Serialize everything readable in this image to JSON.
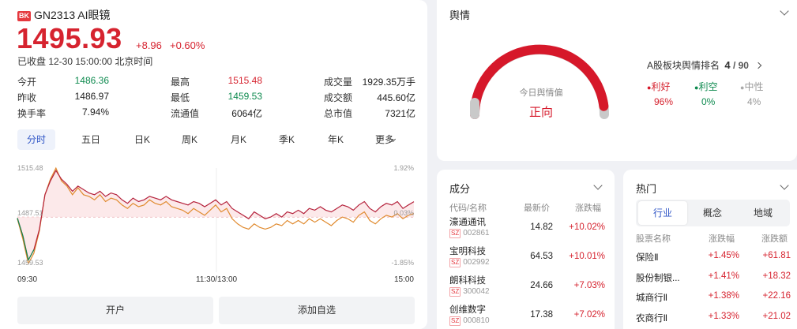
{
  "stock": {
    "badge": "BK",
    "name": "GN2313 AI眼镜",
    "price": "1495.93",
    "change": "+8.96",
    "change_pct": "+0.60%",
    "status": "已收盘 12-30 15:00:00 北京时间"
  },
  "stats": [
    {
      "label": "今开",
      "value": "1486.36",
      "color": "green"
    },
    {
      "label": "最高",
      "value": "1515.48",
      "color": "red"
    },
    {
      "label": "成交量",
      "value": "1929.35万手",
      "color": "dark"
    },
    {
      "label": "昨收",
      "value": "1486.97",
      "color": "dark"
    },
    {
      "label": "最低",
      "value": "1459.53",
      "color": "green"
    },
    {
      "label": "成交额",
      "value": "445.60亿",
      "color": "dark"
    },
    {
      "label": "换手率",
      "value": "7.94%",
      "color": "dark"
    },
    {
      "label": "流通值",
      "value": "6064亿",
      "color": "dark"
    },
    {
      "label": "总市值",
      "value": "7321亿",
      "color": "dark"
    }
  ],
  "tabs": [
    "分时",
    "五日",
    "日K",
    "周K",
    "月K",
    "季K",
    "年K",
    "更多"
  ],
  "chart_data": {
    "type": "line",
    "y_left_ticks": [
      "1515.48",
      "1487.51",
      "1459.53"
    ],
    "y_right_ticks": [
      "1.92%",
      "0.03%",
      "-1.85%"
    ],
    "x_ticks": [
      "09:30",
      "11:30/13:00",
      "15:00"
    ],
    "ylim": [
      1459.53,
      1515.48
    ],
    "prev_close": 1486.97,
    "series": [
      {
        "color": "#b5223c",
        "values": [
          1486.4,
          1476,
          1462,
          1468,
          1480,
          1500,
          1508,
          1514,
          1509,
          1506,
          1502,
          1505,
          1503,
          1501,
          1500,
          1502,
          1499,
          1501,
          1500,
          1497,
          1495,
          1498,
          1496,
          1497,
          1499,
          1498,
          1497,
          1499,
          1497,
          1496,
          1495,
          1494,
          1496,
          1495,
          1493,
          1495,
          1497,
          1494,
          1496,
          1492,
          1490,
          1488,
          1486,
          1490,
          1488,
          1486,
          1487,
          1489,
          1487,
          1490,
          1489,
          1491,
          1489,
          1492,
          1491,
          1493,
          1491,
          1490,
          1492,
          1494,
          1493,
          1491,
          1494,
          1496,
          1492,
          1490,
          1493,
          1495,
          1494,
          1496,
          1492,
          1494,
          1495.93
        ]
      },
      {
        "color": "#e08a2e",
        "values": [
          1486,
          1474,
          1460,
          1466,
          1479,
          1500,
          1509,
          1515.48,
          1508,
          1505,
          1500,
          1504,
          1500,
          1499,
          1497,
          1500,
          1496,
          1498,
          1497,
          1494,
          1492,
          1495,
          1493,
          1494,
          1497,
          1495,
          1494,
          1496,
          1493,
          1492,
          1491,
          1489,
          1492,
          1490,
          1488,
          1491,
          1494,
          1490,
          1492,
          1486,
          1483,
          1481,
          1480,
          1483,
          1481,
          1480,
          1481,
          1483,
          1482,
          1485,
          1483,
          1485,
          1483,
          1486,
          1484,
          1486,
          1484,
          1482,
          1485,
          1487,
          1486,
          1484,
          1488,
          1490,
          1485,
          1483,
          1486,
          1488,
          1487,
          1489,
          1486,
          1488,
          1489
        ]
      }
    ]
  },
  "buttons": {
    "open": "开户",
    "watch": "添加自选"
  },
  "sentiment": {
    "title": "舆情",
    "gauge_label": "今日舆情偏",
    "gauge_value": "正向",
    "rank_label": "A股板块舆情排名",
    "rank": "4",
    "rank_total": "/ 90",
    "bull_label": "利好",
    "bull_pct": "96%",
    "bear_label": "利空",
    "bear_pct": "0%",
    "neutral_label": "中性",
    "neutral_pct": "4%",
    "positive_share": 0.96
  },
  "components": {
    "title": "成分",
    "headers": [
      "代码/名称",
      "最新价",
      "涨跌幅"
    ],
    "rows": [
      {
        "name": "濠通通讯",
        "market": "SZ",
        "code": "002861",
        "price": "14.82",
        "pct": "+10.02%"
      },
      {
        "name": "宝明科技",
        "market": "SZ",
        "code": "002992",
        "price": "64.53",
        "pct": "+10.01%"
      },
      {
        "name": "朗科科技",
        "market": "SZ",
        "code": "300042",
        "price": "24.66",
        "pct": "+7.03%"
      },
      {
        "name": "创维数字",
        "market": "SZ",
        "code": "000810",
        "price": "17.38",
        "pct": "+7.02%"
      }
    ]
  },
  "hot": {
    "title": "热门",
    "segments": [
      "行业",
      "概念",
      "地域"
    ],
    "headers": [
      "股票名称",
      "涨跌幅",
      "涨跌额"
    ],
    "rows": [
      {
        "name": "保险Ⅱ",
        "pct": "+1.45%",
        "amt": "+61.81"
      },
      {
        "name": "股份制银...",
        "pct": "+1.41%",
        "amt": "+18.32"
      },
      {
        "name": "城商行Ⅱ",
        "pct": "+1.38%",
        "amt": "+22.16"
      },
      {
        "name": "农商行Ⅱ",
        "pct": "+1.33%",
        "amt": "+21.02"
      }
    ]
  }
}
